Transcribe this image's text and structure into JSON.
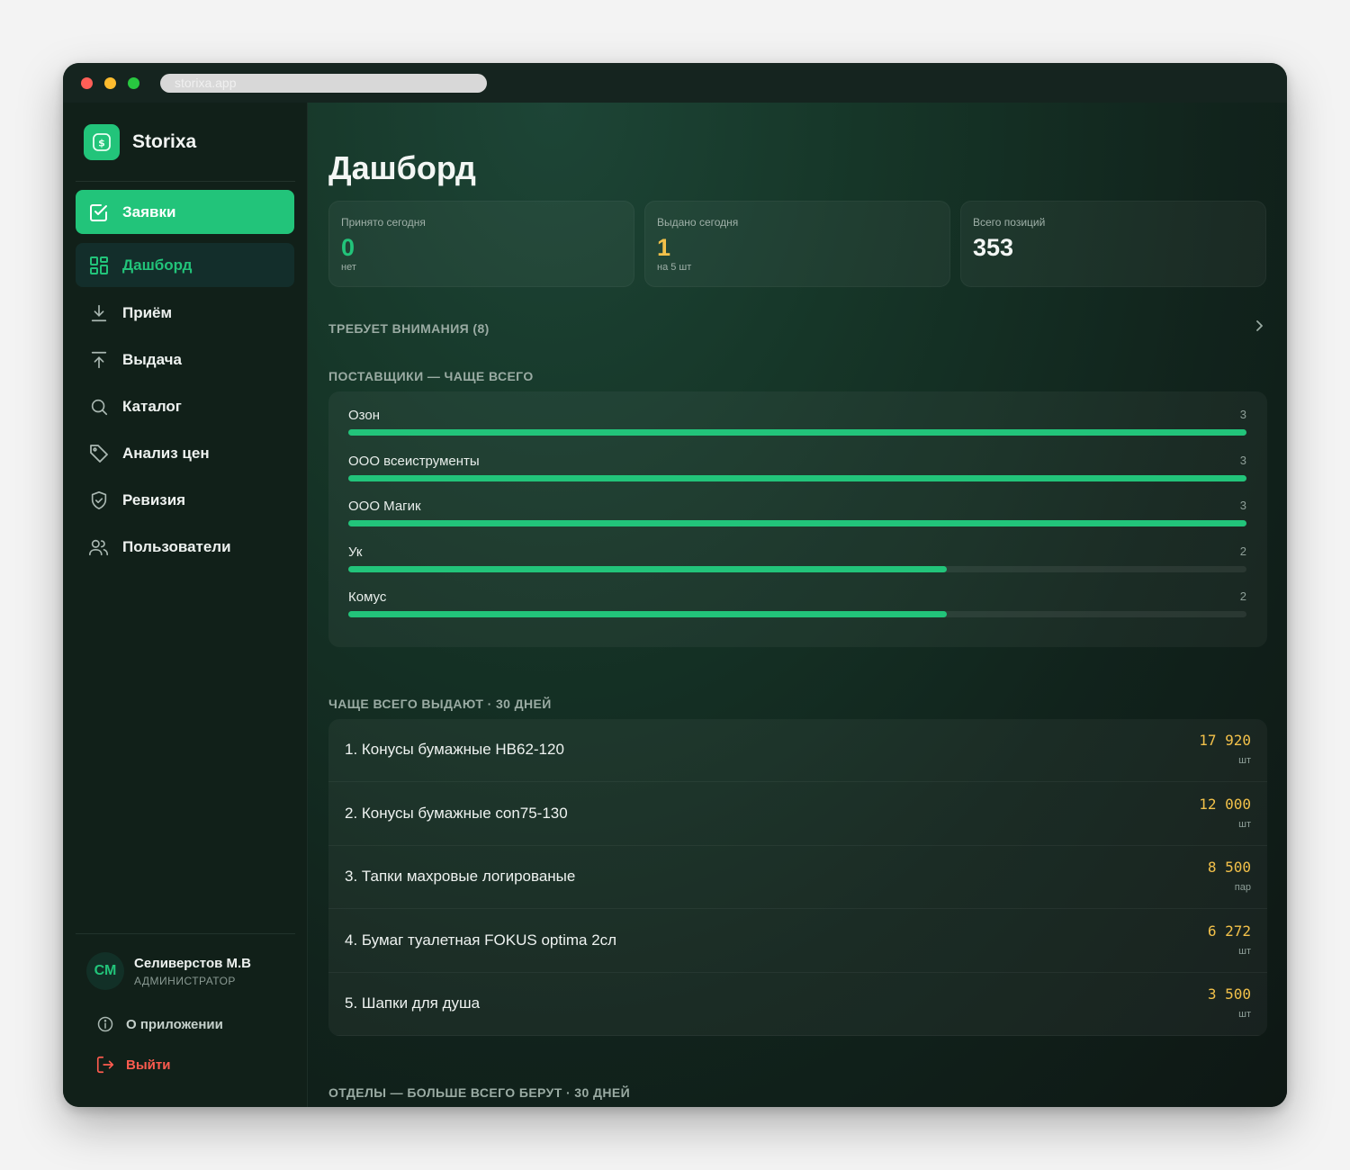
{
  "browser": {
    "url": "storixa.app"
  },
  "brand": {
    "name": "Storixa",
    "logo_glyph": "$"
  },
  "sidebar": {
    "items": [
      {
        "label": "Заявки",
        "icon": "checkbox-edit-icon",
        "state": "primary"
      },
      {
        "label": "Дашборд",
        "icon": "dashboard-grid-icon",
        "state": "active"
      },
      {
        "label": "Приём",
        "icon": "download-icon"
      },
      {
        "label": "Выдача",
        "icon": "upload-icon"
      },
      {
        "label": "Каталог",
        "icon": "search-icon"
      },
      {
        "label": "Анализ цен",
        "icon": "tag-icon"
      },
      {
        "label": "Ревизия",
        "icon": "shield-check-icon"
      },
      {
        "label": "Пользователи",
        "icon": "users-icon"
      }
    ],
    "user": {
      "initials": "СМ",
      "name": "Селиверстов М.В",
      "role": "АДМИНИСТРАТОР"
    },
    "about": "О приложении",
    "logout": "Выйти"
  },
  "main": {
    "title": "Дашборд",
    "stats": [
      {
        "label": "Принято сегодня",
        "value": "0",
        "sub": "нет",
        "color": "#22c47a"
      },
      {
        "label": "Выдано сегодня",
        "value": "1",
        "sub": "на 5 шт",
        "color": "#f3c14a"
      },
      {
        "label": "Всего позиций",
        "value": "353",
        "sub": "",
        "color": "#f3f6f4"
      }
    ],
    "attention_label": "ТРЕБУЕТ ВНИМАНИЯ (8)",
    "suppliers_label": "ПОСТАВЩИКИ — ЧАЩЕ ВСЕГО",
    "suppliers": [
      {
        "name": "Озон",
        "count": 3
      },
      {
        "name": "ООО всеиструменты",
        "count": 3
      },
      {
        "name": "ООО Магик",
        "count": 3
      },
      {
        "name": "Ук",
        "count": 2
      },
      {
        "name": "Комус",
        "count": 2
      }
    ],
    "top_label": "ЧАЩЕ ВСЕГО ВЫДАЮТ · 30 ДНЕЙ",
    "top_items": [
      {
        "name": "1. Конусы бумажные НВ62-120",
        "qty": "17 920",
        "unit": "шт"
      },
      {
        "name": "2. Конусы бумажные con75-130",
        "qty": "12 000",
        "unit": "шт"
      },
      {
        "name": "3. Тапки махровые логированые",
        "qty": "8 500",
        "unit": "пар"
      },
      {
        "name": "4. Бумаг туалетная FOKUS optima 2сл",
        "qty": "6 272",
        "unit": "шт"
      },
      {
        "name": "5. Шапки для душа",
        "qty": "3 500",
        "unit": "шт"
      }
    ],
    "departments_label": "ОТДЕЛЫ — БОЛЬШЕ ВСЕГО БЕРУТ · 30 ДНЕЙ"
  },
  "colors": {
    "accent": "#22c47a",
    "warning": "#f3c14a",
    "danger": "#ff5b4f"
  }
}
